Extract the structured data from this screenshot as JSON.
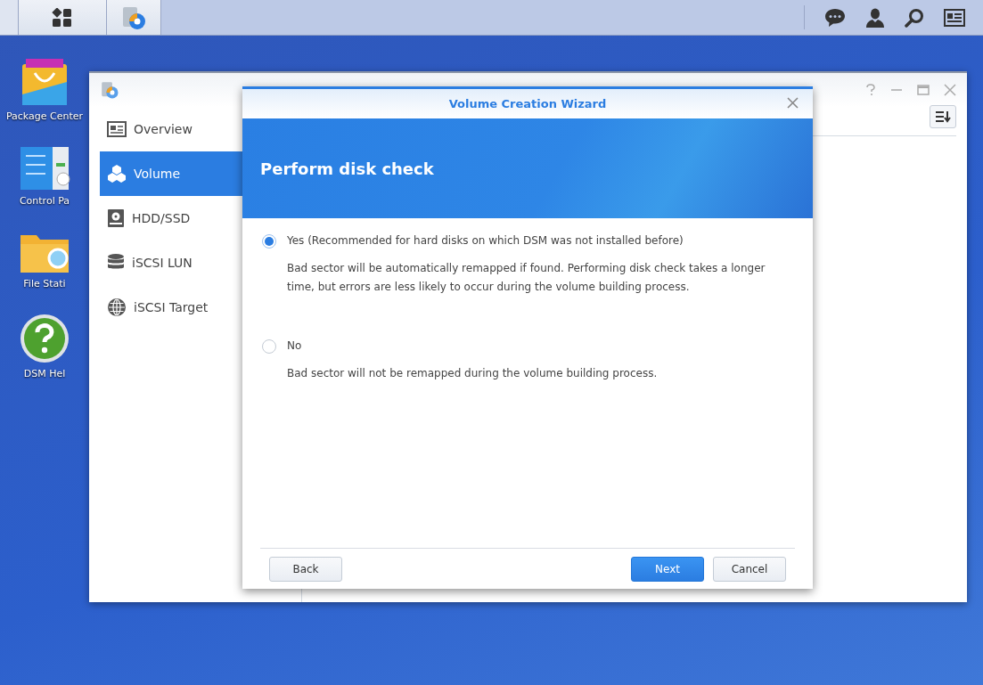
{
  "desktop_icons": [
    {
      "kind": "package",
      "label": "Package Center"
    },
    {
      "kind": "control",
      "label": "Control Pa"
    },
    {
      "kind": "folder",
      "label": "File Stati"
    },
    {
      "kind": "help",
      "label": "DSM Hel"
    }
  ],
  "sidebar": {
    "items": [
      {
        "kind": "overview",
        "label": "Overview",
        "selected": false
      },
      {
        "kind": "volume",
        "label": "Volume",
        "selected": true
      },
      {
        "kind": "disk",
        "label": "HDD/SSD",
        "selected": false
      },
      {
        "kind": "lun",
        "label": "iSCSI LUN",
        "selected": false
      },
      {
        "kind": "target",
        "label": "iSCSI Target",
        "selected": false
      }
    ]
  },
  "wizard": {
    "title": "Volume Creation Wizard",
    "heading": "Perform disk check",
    "options": [
      {
        "label": "Yes (Recommended for hard disks on which DSM was not installed before)",
        "description": "Bad sector will be automatically remapped if found. Performing disk check takes a longer time, but errors are less likely to occur during the volume building process.",
        "selected": true
      },
      {
        "label": "No",
        "description": "Bad sector will not be remapped during the volume building process.",
        "selected": false
      }
    ],
    "buttons": [
      {
        "kind": "secondary",
        "label": "Back"
      },
      {
        "kind": "primary",
        "label": "Next"
      },
      {
        "kind": "secondary",
        "label": "Cancel"
      }
    ]
  }
}
